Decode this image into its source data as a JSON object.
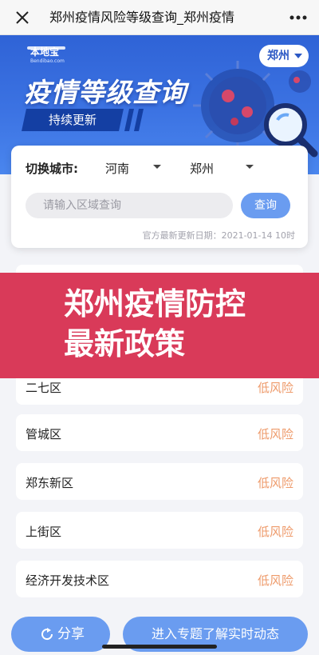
{
  "topbar": {
    "title": "郑州疫情风险等级查询_郑州疫情",
    "close_icon": "close-icon",
    "more_icon": "more-icon"
  },
  "banner": {
    "logo_text": "本地宝",
    "logo_sub": "Bendibao.com",
    "heading": "疫情等级查询",
    "update_label": "持续更新",
    "city": "郑州",
    "colors": {
      "bg": "#3c73e3",
      "tag": "#143fa3"
    }
  },
  "search_card": {
    "switch_label": "切换城市:",
    "province": "河南",
    "city": "郑州",
    "search_placeholder": "请输入区域查询",
    "search_value": "",
    "query_label": "查询",
    "update_date": "官方最新更新日期：2021-01-14 10时"
  },
  "districts": [
    {
      "name": "二七区",
      "risk": "低风险"
    },
    {
      "name": "管城区",
      "risk": "低风险"
    },
    {
      "name": "郑东新区",
      "risk": "低风险"
    },
    {
      "name": "上街区",
      "risk": "低风险"
    },
    {
      "name": "经济开发技术区",
      "risk": "低风险"
    }
  ],
  "overlay": {
    "title": "郑州疫情防控最新政策",
    "color": "#d93a59"
  },
  "bottom": {
    "share_label": "分享",
    "enter_label": "进入专题了解实时动态",
    "accent": "#6a9cf0"
  }
}
